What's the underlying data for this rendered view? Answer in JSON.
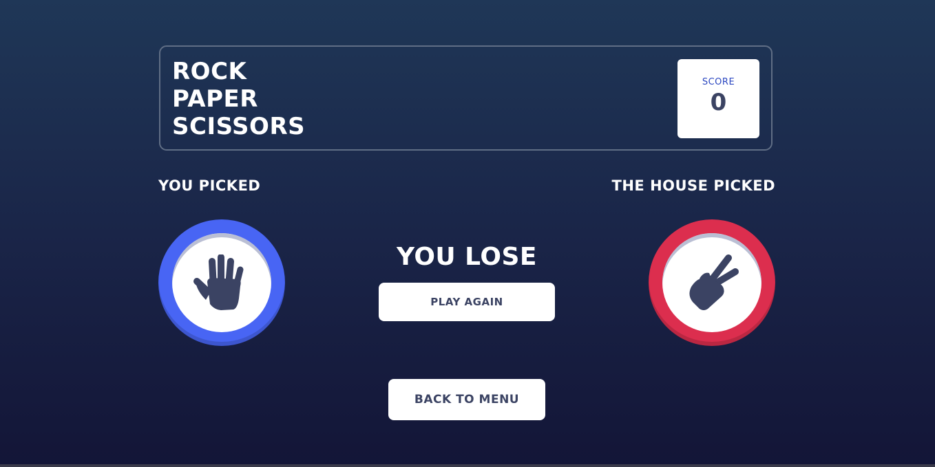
{
  "header": {
    "title_lines": [
      "ROCK",
      "PAPER",
      "SCISSORS"
    ],
    "score_label": "SCORE",
    "score_value": "0"
  },
  "player": {
    "label": "YOU PICKED",
    "choice": "paper",
    "icon": "hand-paper-icon",
    "ring_color": "#4865f4"
  },
  "house": {
    "label": "THE HOUSE PICKED",
    "choice": "scissors",
    "icon": "hand-scissors-icon",
    "ring_color": "#dc2e4e"
  },
  "result": {
    "text": "YOU LOSE",
    "play_again_label": "PLAY AGAIN"
  },
  "back_to_menu_label": "BACK TO MENU",
  "colors": {
    "text_dark": "#3b4363",
    "score_label": "#2a46c0",
    "header_outline": "#606e85"
  }
}
